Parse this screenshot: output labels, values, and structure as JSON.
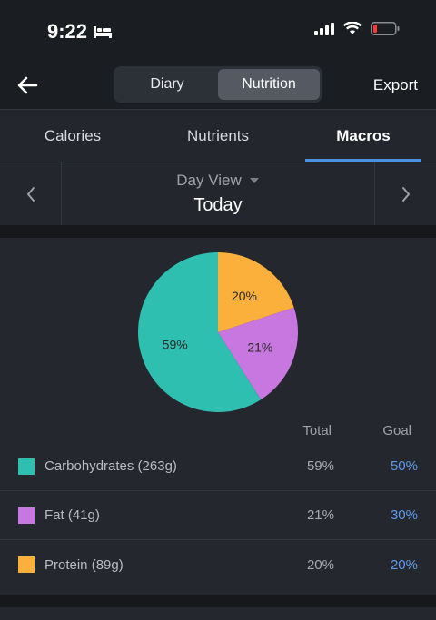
{
  "status": {
    "time": "9:22"
  },
  "header": {
    "segments": [
      {
        "label": "Diary",
        "active": false
      },
      {
        "label": "Nutrition",
        "active": true
      }
    ],
    "export_label": "Export"
  },
  "tabs": [
    {
      "label": "Calories",
      "active": false
    },
    {
      "label": "Nutrients",
      "active": false
    },
    {
      "label": "Macros",
      "active": true
    }
  ],
  "day": {
    "view_label": "Day View",
    "date_label": "Today"
  },
  "columns": {
    "total": "Total",
    "goal": "Goal"
  },
  "macros": [
    {
      "label": "Carbohydrates (263g)",
      "total": "59%",
      "goal": "50%",
      "color": "#2ebfb1"
    },
    {
      "label": "Fat (41g)",
      "total": "21%",
      "goal": "30%",
      "color": "#c877e0"
    },
    {
      "label": "Protein (89g)",
      "total": "20%",
      "goal": "20%",
      "color": "#fbb03b"
    }
  ],
  "chart_data": {
    "type": "pie",
    "slices": [
      {
        "label": "Protein",
        "value": 20,
        "display": "20%",
        "color": "#fbb03b"
      },
      {
        "label": "Fat",
        "value": 21,
        "display": "21%",
        "color": "#c877e0"
      },
      {
        "label": "Carbohydrates",
        "value": 59,
        "display": "59%",
        "color": "#2ebfb1"
      }
    ],
    "start": "12 o'clock, clockwise"
  },
  "colors": {
    "accent": "#4a8fe0",
    "goal_text": "#5d9bea"
  }
}
